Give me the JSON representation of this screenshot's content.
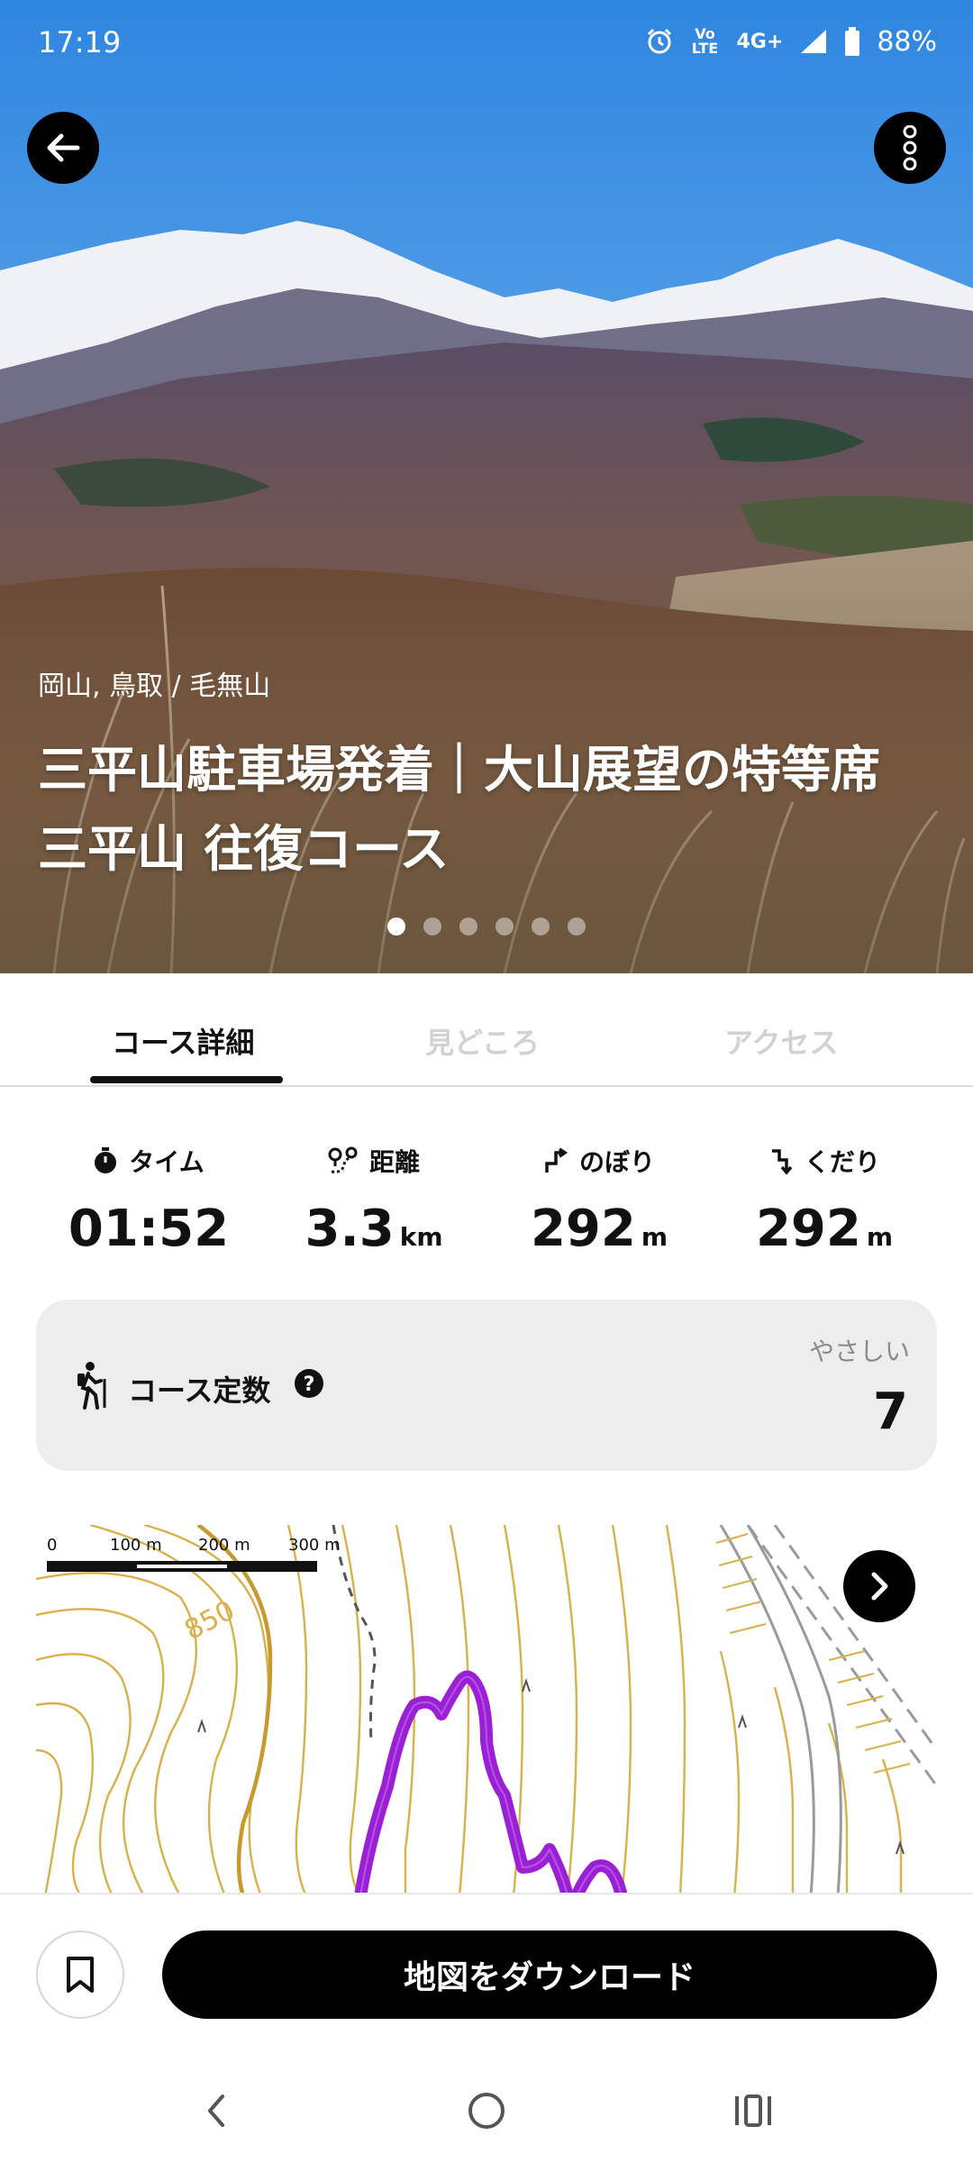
{
  "status_bar": {
    "time": "17:19",
    "volte": "Vo LTE",
    "network": "4G+",
    "battery": "88%",
    "icons": [
      "alarm-icon",
      "signal-icon",
      "battery-icon"
    ]
  },
  "hero": {
    "location": "岡山, 鳥取 / 毛無山",
    "title": "三平山駐車場発着｜大山展望の特等席 三平山 往復コース",
    "photo_count": 6,
    "active_photo": 1
  },
  "tabs": [
    {
      "label": "コース詳細",
      "active": true
    },
    {
      "label": "見どころ",
      "active": false
    },
    {
      "label": "アクセス",
      "active": false
    }
  ],
  "stats": {
    "time": {
      "label": "タイム",
      "value": "01:52",
      "unit": ""
    },
    "distance": {
      "label": "距離",
      "value": "3.3",
      "unit": "km"
    },
    "ascent": {
      "label": "のぼり",
      "value": "292",
      "unit": "m"
    },
    "descent": {
      "label": "くだり",
      "value": "292",
      "unit": "m"
    }
  },
  "course_constant": {
    "label": "コース定数",
    "level": "やさしい",
    "value": "7"
  },
  "map": {
    "scale_labels": [
      "0",
      "100 m",
      "200 m",
      "300 m"
    ],
    "contour_label": "850",
    "route_color": "#9b1fd6",
    "contour_color": "#d9b04a"
  },
  "actions": {
    "download_label": "地図をダウンロード"
  },
  "colors": {
    "accent": "#000000",
    "tab_inactive": "#d2d2d2",
    "card_bg": "#ededed"
  }
}
